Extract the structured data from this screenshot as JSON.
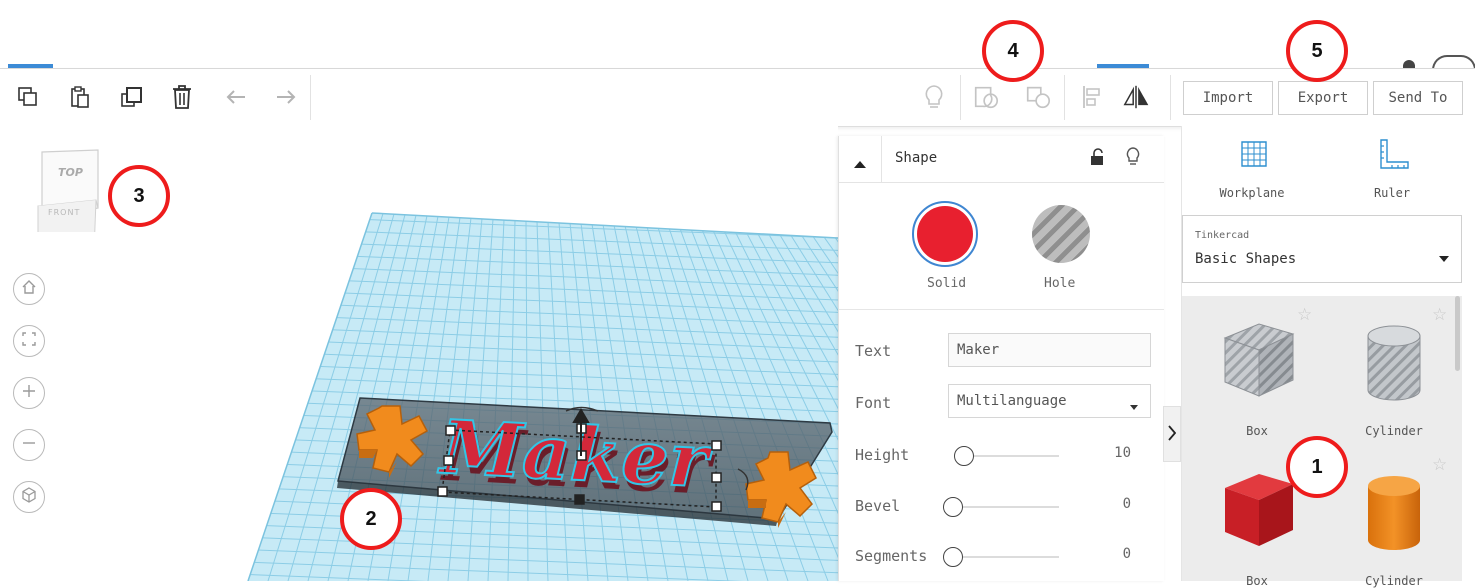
{
  "toolbar": {
    "import_label": "Import",
    "export_label": "Export",
    "sendto_label": "Send To"
  },
  "viewcube": {
    "top": "TOP",
    "front": "FRONT"
  },
  "scene": {
    "text_object": "Maker"
  },
  "inspector": {
    "title": "Shape",
    "solid_label": "Solid",
    "hole_label": "Hole",
    "solid_color": "#e8202f",
    "text_label": "Text",
    "text_value": "Maker",
    "font_label": "Font",
    "font_value": "Multilanguage",
    "height_label": "Height",
    "height_value": "10",
    "bevel_label": "Bevel",
    "bevel_value": "0",
    "segments_label": "Segments",
    "segments_value": "0"
  },
  "sidebar": {
    "workplane_label": "Workplane",
    "ruler_label": "Ruler",
    "library_source": "Tinkercad",
    "library_name": "Basic Shapes",
    "shapes": [
      {
        "label": "Box",
        "style": "hole"
      },
      {
        "label": "Cylinder",
        "style": "hole"
      },
      {
        "label": "Box",
        "style": "solid-red"
      },
      {
        "label": "Cylinder",
        "style": "solid-orange"
      }
    ]
  },
  "callouts": [
    "1",
    "2",
    "3",
    "4",
    "5"
  ],
  "colors": {
    "grid": "#8fd3ec",
    "text_red": "#d3283a",
    "gear_orange": "#f18b1d",
    "callout_ring": "#ee1c1c"
  }
}
